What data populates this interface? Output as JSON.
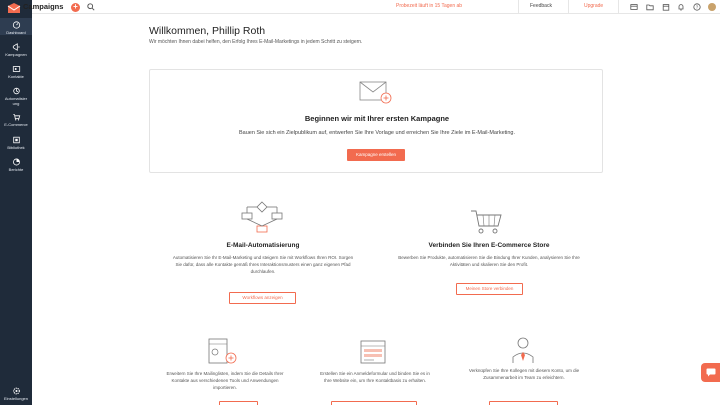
{
  "topbar": {
    "app_title": "Campaigns",
    "plus_label": "+",
    "trial_text": "Probezeit läuft in 15 Tagen ab",
    "feedback_label": "Feedback",
    "upgrade_label": "Upgrade"
  },
  "sidebar": {
    "items": [
      {
        "label": "Dashboard",
        "icon": "dashboard-icon"
      },
      {
        "label": "Kampagnen",
        "icon": "megaphone-icon"
      },
      {
        "label": "Kontakte",
        "icon": "contacts-icon"
      },
      {
        "label": "Automatisier ung",
        "icon": "automation-icon"
      },
      {
        "label": "E-Commerce",
        "icon": "cart-icon"
      },
      {
        "label": "Bibliothek",
        "icon": "library-icon"
      },
      {
        "label": "Berichte",
        "icon": "reports-icon"
      }
    ],
    "settings_label": "Einstellungen"
  },
  "main": {
    "welcome_title": "Willkommen, Phillip Roth",
    "welcome_sub": "Wir möchten Ihnen dabei helfen, den Erfolg Ihres E-Mail-Marketings in jedem Schritt zu steigern.",
    "hero": {
      "title": "Beginnen wir mit Ihrer ersten Kampagne",
      "desc": "Bauen Sie sich ein Zielpublikum auf, entwerfen Sie Ihre Vorlage und erreichen Sie Ihre Ziele im E-Mail-Marketing.",
      "button": "Kampagne erstellen"
    },
    "features": [
      {
        "title": "E-Mail-Automatisierung",
        "desc_lines": [
          "Automatisieren Sie Ihr E-Mail-Marketing und steigern Sie mit Workflows Ihren ROI. Sorgen",
          "Sie dafür, dass alle Kontakte gemäß Ihres Interaktionsmusters einen ganz eigenen Pfad",
          "durchlaufen."
        ],
        "button": "Workflows anzeigen"
      },
      {
        "title": "Verbinden Sie Ihren E-Commerce Store",
        "desc_lines": [
          "Bewerben Sie Produkte, automatisieren Sie die Bindung Ihrer Kunden, analysieren Sie Ihre",
          "Aktivitäten und skalieren Sie den Profit."
        ],
        "button": "Meinen Store verbinden"
      }
    ],
    "bottom": [
      {
        "desc_lines": [
          "Erweitern Sie Ihre Mailinglisten, indem Sie die Details Ihrer",
          "Kontakte aus verschiedenen Tools und Anwendungen",
          "importieren."
        ]
      },
      {
        "desc_lines": [
          "Erstellen Sie ein Anmeldeformular und binden Sie es in",
          "Ihre Website ein, um Ihre Kontaktbasis zu erhalten."
        ]
      },
      {
        "desc_lines": [
          "Verknüpfen Sie Ihre Kollegen mit diesem Konto, um die",
          "Zusammenarbeit im Team zu erleichtern."
        ]
      }
    ]
  },
  "colors": {
    "accent": "#f26b4f",
    "sidebar": "#1f2b3a"
  }
}
